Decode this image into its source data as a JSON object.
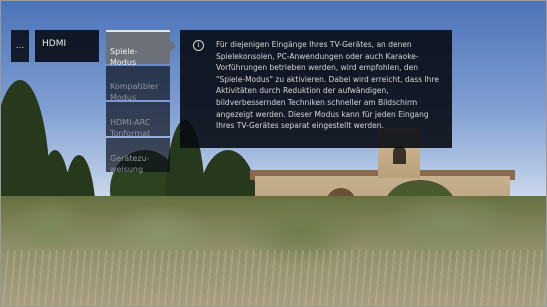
{
  "breadcrumb": {
    "previous_label": "...",
    "current_label": "HDMI"
  },
  "options": [
    {
      "label": "Spiele-\nModus",
      "selected": true
    },
    {
      "label": "Kompatibler\nModus",
      "selected": false
    },
    {
      "label": "HDMI-ARC\nTonformat",
      "selected": false
    },
    {
      "label": "Gerätezu-\nweisung",
      "selected": false
    }
  ],
  "info": {
    "icon": "info-icon",
    "text": "Für diejenigen Eingänge Ihres TV-Gerätes, an denen Spielekonsolen, PC-Anwendungen oder auch Karaoke-Vorführungen betrieben werden, wird empfohlen, den \"Spiele-Modus\" zu aktivieren. Dabei wird erreicht, dass Ihre Aktivitäten durch Reduktion der aufwändigen, bildverbessernden Techniken schneller am Bildschirm angezeigt werden. Dieser Modus kann für jeden Eingang Ihres TV-Gerätes separat eingestellt werden."
  },
  "colors": {
    "panel_bg": "#0b0f18",
    "selected_bg": "#6b7079",
    "text": "#d6d6d6"
  }
}
